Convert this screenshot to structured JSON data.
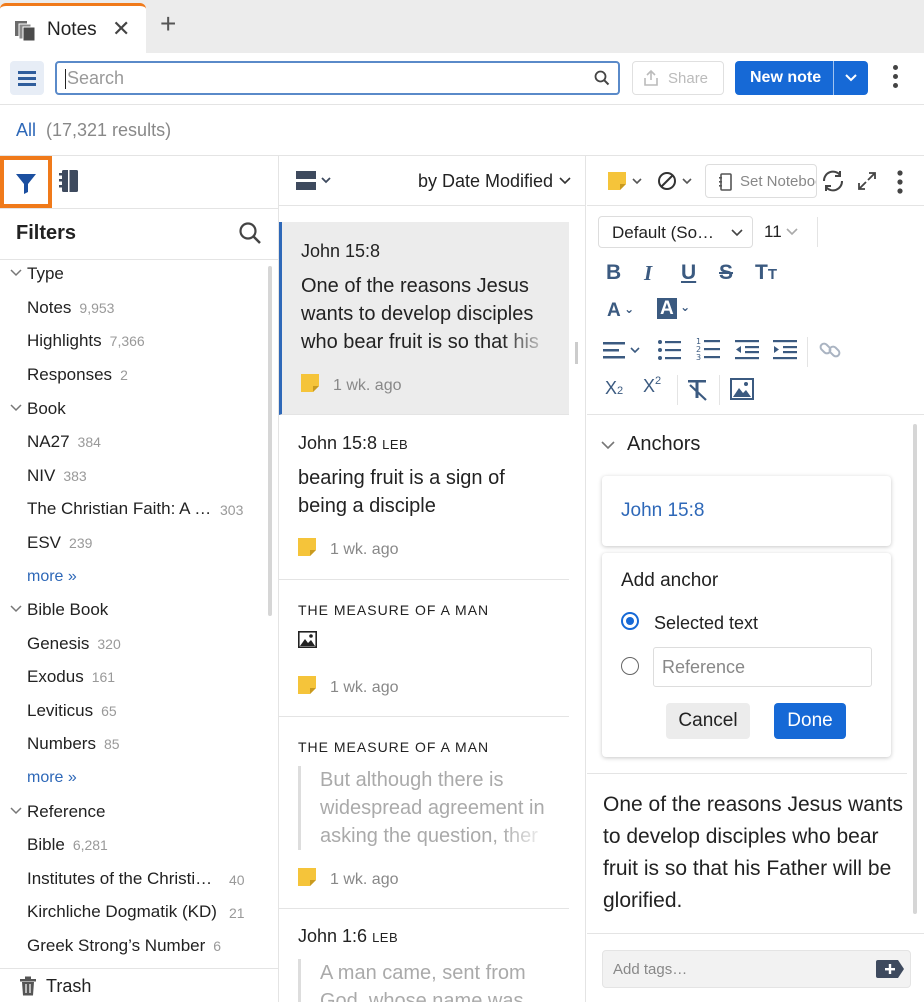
{
  "tabs": {
    "active_label": "Notes"
  },
  "toolbar": {
    "search_placeholder": "Search",
    "share_label": "Share",
    "new_note_label": "New note"
  },
  "results": {
    "scope": "All",
    "count": "(17,321 results)"
  },
  "filters": {
    "title": "Filters",
    "groups": [
      {
        "label": "Type",
        "items": [
          {
            "label": "Notes",
            "count": "9,953"
          },
          {
            "label": "Highlights",
            "count": "7,366"
          },
          {
            "label": "Responses",
            "count": "2"
          }
        ]
      },
      {
        "label": "Book",
        "items": [
          {
            "label": "NA27",
            "count": "384"
          },
          {
            "label": "NIV",
            "count": "383"
          },
          {
            "label": "The Christian Faith: A …",
            "count": "303"
          },
          {
            "label": "ESV",
            "count": "239"
          }
        ],
        "more": "more »"
      },
      {
        "label": "Bible Book",
        "items": [
          {
            "label": "Genesis",
            "count": "320"
          },
          {
            "label": "Exodus",
            "count": "161"
          },
          {
            "label": "Leviticus",
            "count": "65"
          },
          {
            "label": "Numbers",
            "count": "85"
          }
        ],
        "more": "more »"
      },
      {
        "label": "Reference",
        "items": [
          {
            "label": "Bible",
            "count": "6,281"
          },
          {
            "label": "Institutes of the Christi…",
            "count": "40"
          },
          {
            "label": "Kirchliche Dogmatik (KD)",
            "count": "21"
          },
          {
            "label": "Greek Strong’s Number",
            "count": "6"
          }
        ]
      }
    ],
    "trash_label": "Trash"
  },
  "list": {
    "sort_label": "by Date Modified",
    "notes": [
      {
        "ref": "John 15:8",
        "ref_suffix": "",
        "body": "One of the reasons Jesus wants to develop disciples who bear fruit is so that his",
        "time": "1 wk. ago"
      },
      {
        "ref": "John 15:8",
        "ref_suffix": "LEB",
        "body": "bearing fruit is a sign of being a disciple",
        "time": "1 wk. ago"
      },
      {
        "ref": "THE MEASURE OF A MAN",
        "ref_suffix": "",
        "body": "",
        "time": "1 wk. ago"
      },
      {
        "ref": "THE MEASURE OF A MAN",
        "ref_suffix": "",
        "quote": "But although there is widespread agreement in asking the question, ther",
        "time": "1 wk. ago"
      },
      {
        "ref": "John 1:6",
        "ref_suffix": "LEB",
        "quote": "A man came, sent from God, whose name was",
        "time": ""
      }
    ]
  },
  "editor": {
    "set_notebook_label": "Set Notebook",
    "font_family": "Default (So…",
    "font_size": "11",
    "anchors_title": "Anchors",
    "anchor_ref": "John 15:8",
    "add_anchor_title": "Add anchor",
    "option_selected_text": "Selected text",
    "reference_placeholder": "Reference",
    "cancel_label": "Cancel",
    "done_label": "Done",
    "note_text": "One of the reasons Jesus wants to develop disciples who bear fruit is so that his Father will be glorified.",
    "tags_placeholder": "Add tags…"
  },
  "colors": {
    "accent_blue": "#1669d6",
    "link_blue": "#2e68b8",
    "highlight_orange": "#f07a1a",
    "sticky_yellow": "#f5c43a"
  }
}
